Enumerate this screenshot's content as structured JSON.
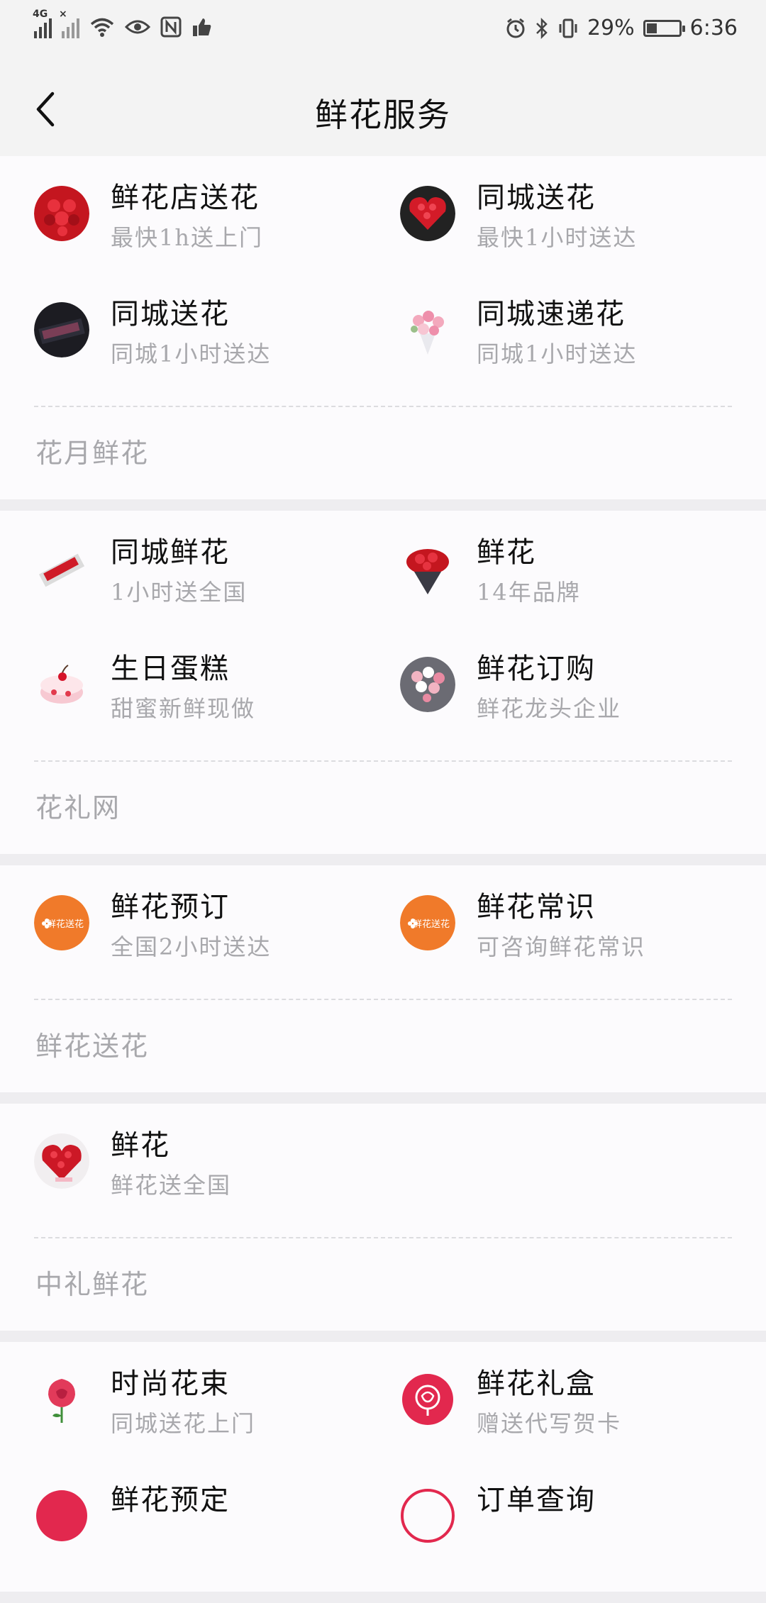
{
  "status_bar": {
    "network": "4G",
    "battery": "29%",
    "time": "6:36"
  },
  "header": {
    "title": "鲜花服务"
  },
  "sections": [
    {
      "provider": "花月鲜花",
      "items": [
        {
          "title": "鲜花店送花",
          "subtitle": "最快1h送上门",
          "icon": "red-roses-circle-icon"
        },
        {
          "title": "同城送花",
          "subtitle": "最快1小时送达",
          "icon": "heart-rose-box-icon"
        },
        {
          "title": "同城送花",
          "subtitle": "同城1小时送达",
          "icon": "black-gift-box-icon"
        },
        {
          "title": "同城速递花",
          "subtitle": "同城1小时送达",
          "icon": "pink-bouquet-icon"
        }
      ]
    },
    {
      "provider": "花礼网",
      "items": [
        {
          "title": "同城鲜花",
          "subtitle": "1小时送全国",
          "icon": "rose-gift-box-icon"
        },
        {
          "title": "鲜花",
          "subtitle": "14年品牌",
          "icon": "red-rose-bouquet-icon"
        },
        {
          "title": "生日蛋糕",
          "subtitle": "甜蜜新鲜现做",
          "icon": "birthday-cake-icon"
        },
        {
          "title": "鲜花订购",
          "subtitle": "鲜花龙头企业",
          "icon": "mixed-flower-bouquet-icon"
        }
      ]
    },
    {
      "provider": "鲜花送花",
      "items": [
        {
          "title": "鲜花预订",
          "subtitle": "全国2小时送达",
          "icon": "orange-logo-icon",
          "logo_text": "鲜花送花"
        },
        {
          "title": "鲜花常识",
          "subtitle": "可咨询鲜花常识",
          "icon": "orange-logo-icon",
          "logo_text": "鲜花送花"
        }
      ]
    },
    {
      "provider": "中礼鲜花",
      "items": [
        {
          "title": "鲜花",
          "subtitle": "鲜花送全国",
          "icon": "heart-roses-icon"
        }
      ]
    },
    {
      "provider": "",
      "items": [
        {
          "title": "时尚花束",
          "subtitle": "同城送花上门",
          "icon": "rose-icon"
        },
        {
          "title": "鲜花礼盒",
          "subtitle": "赠送代写贺卡",
          "icon": "rose-badge-icon"
        },
        {
          "title": "鲜花预定",
          "subtitle": "",
          "icon": "flower-icon"
        },
        {
          "title": "订单查询",
          "subtitle": "",
          "icon": "order-icon"
        }
      ]
    }
  ],
  "colors": {
    "background": "#eeedf0",
    "card": "#fcfbfd",
    "subtitle": "#a8a8ac",
    "accent_orange": "#f07a2a",
    "rose_red": "#d81c2c"
  }
}
